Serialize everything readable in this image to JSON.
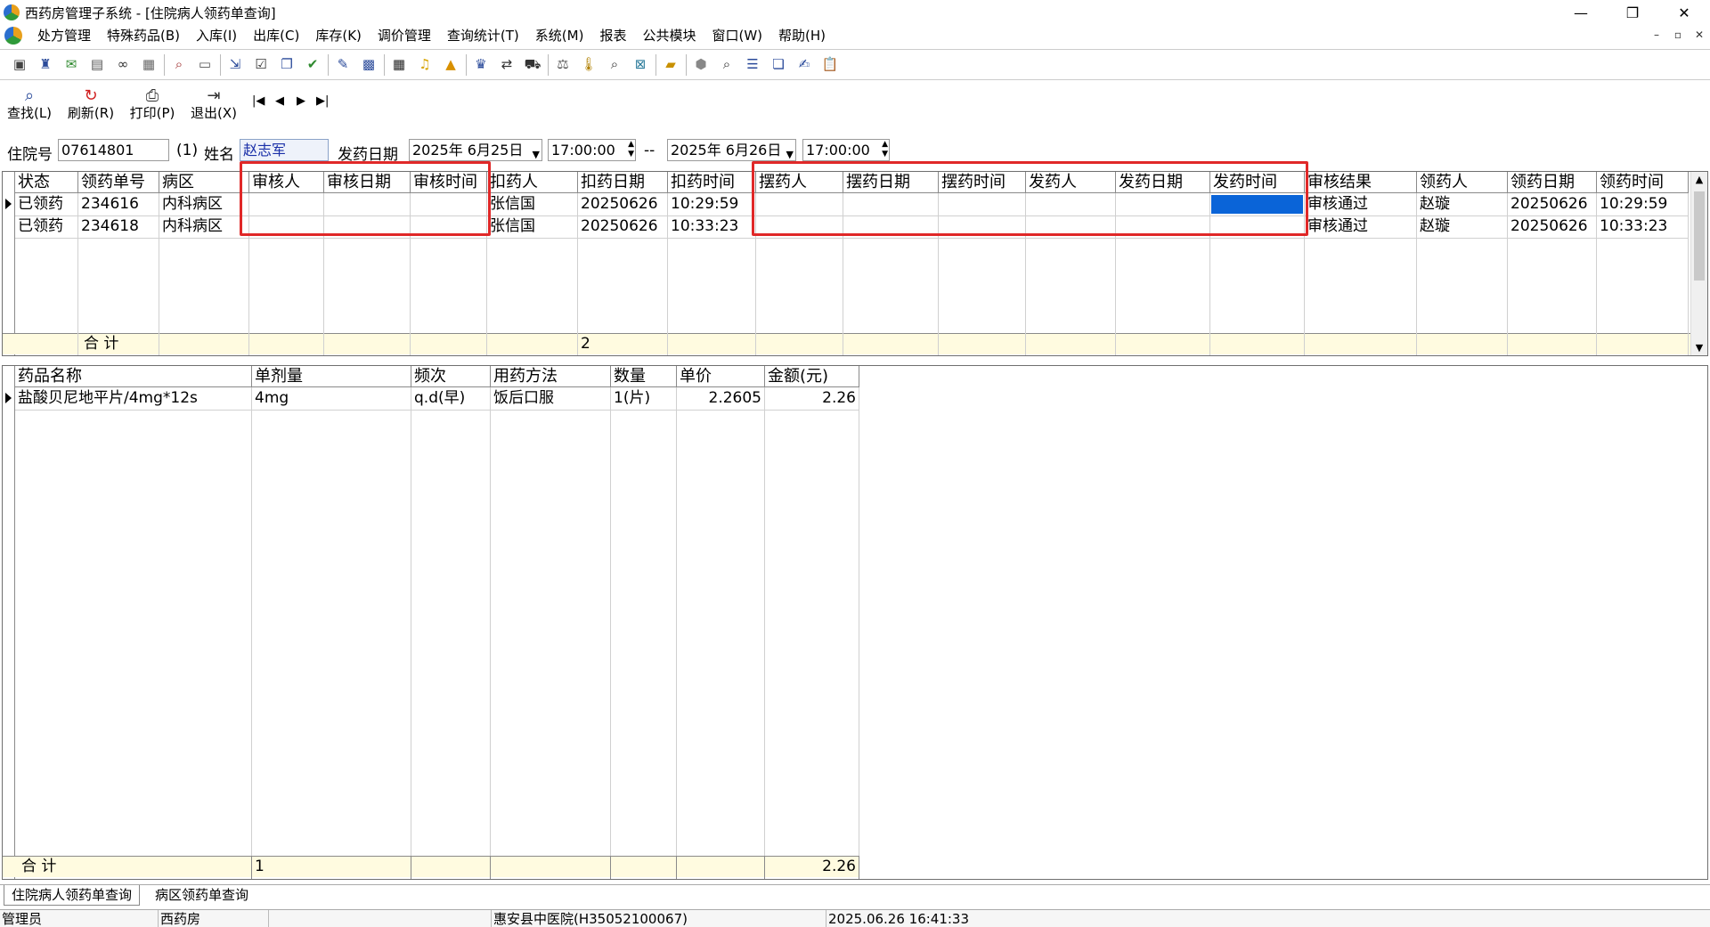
{
  "window": {
    "title": "西药房管理子系统 - [住院病人领药单查询]",
    "minimize": "—",
    "restore": "❐",
    "close": "✕"
  },
  "menu": [
    "处方管理",
    "特殊药品(B)",
    "入库(I)",
    "出库(C)",
    "库存(K)",
    "调价管理",
    "查询统计(T)",
    "系统(M)",
    "报表",
    "公共模块",
    "窗口(W)",
    "帮助(H)"
  ],
  "mdi": {
    "min": "–",
    "restore": "▫",
    "close": "✕"
  },
  "actions": {
    "find": "查找(L)",
    "refresh": "刷新(R)",
    "print": "打印(P)",
    "exit": "退出(X)"
  },
  "nav": {
    "first": "|◀",
    "prev": "◀",
    "next": "▶",
    "last": "▶|"
  },
  "query": {
    "inpatient_label": "住院号",
    "inpatient_value": "07614801",
    "visit_no": "(1)",
    "name_label": "姓名",
    "name_value": "赵志军",
    "date_label": "发药日期",
    "date_from": "2025年 6月25日",
    "time_from": "17:00:00",
    "dash": "--",
    "date_to": "2025年 6月26日",
    "time_to": "17:00:00"
  },
  "top_grid": {
    "columns": [
      "状态",
      "领药单号",
      "病区",
      "审核人",
      "审核日期",
      "审核时间",
      "扣药人",
      "扣药日期",
      "扣药时间",
      "摆药人",
      "摆药日期",
      "摆药时间",
      "发药人",
      "发药日期",
      "发药时间",
      "审核结果",
      "领药人",
      "领药日期",
      "领药时间"
    ],
    "rows": [
      [
        "已领药",
        "234616",
        "内科病区",
        "",
        "",
        "",
        "张信国",
        "20250626",
        "10:29:59",
        "",
        "",
        "",
        "",
        "",
        "",
        "审核通过",
        "赵璇",
        "20250626",
        "10:29:59"
      ],
      [
        "已领药",
        "234618",
        "内科病区",
        "",
        "",
        "",
        "张信国",
        "20250626",
        "10:33:23",
        "",
        "",
        "",
        "",
        "",
        "",
        "审核通过",
        "赵璇",
        "20250626",
        "10:33:23"
      ]
    ],
    "footer_label": "合  计",
    "footer_count": "2"
  },
  "bottom_grid": {
    "columns": [
      "药品名称",
      "单剂量",
      "频次",
      "用药方法",
      "数量",
      "单价",
      "金额(元)"
    ],
    "rows": [
      [
        "盐酸贝尼地平片/4mg*12s",
        "4mg",
        "q.d(早)",
        "饭后口服",
        "1(片)",
        "2.2605",
        "2.26"
      ]
    ],
    "footer_label": "合  计",
    "footer_dose": "1",
    "footer_amount": "2.26"
  },
  "tabs": [
    "住院病人领药单查询",
    "病区领药单查询"
  ],
  "status": {
    "user": "管理员",
    "dept": "西药房",
    "blank": "",
    "hospital": "惠安县中医院(H35052100067)",
    "datetime": "2025.06.26 16:41:33"
  },
  "colors": {
    "highlight": "#e02828",
    "selection": "#0a64d8",
    "footer": "#fffbe0"
  }
}
